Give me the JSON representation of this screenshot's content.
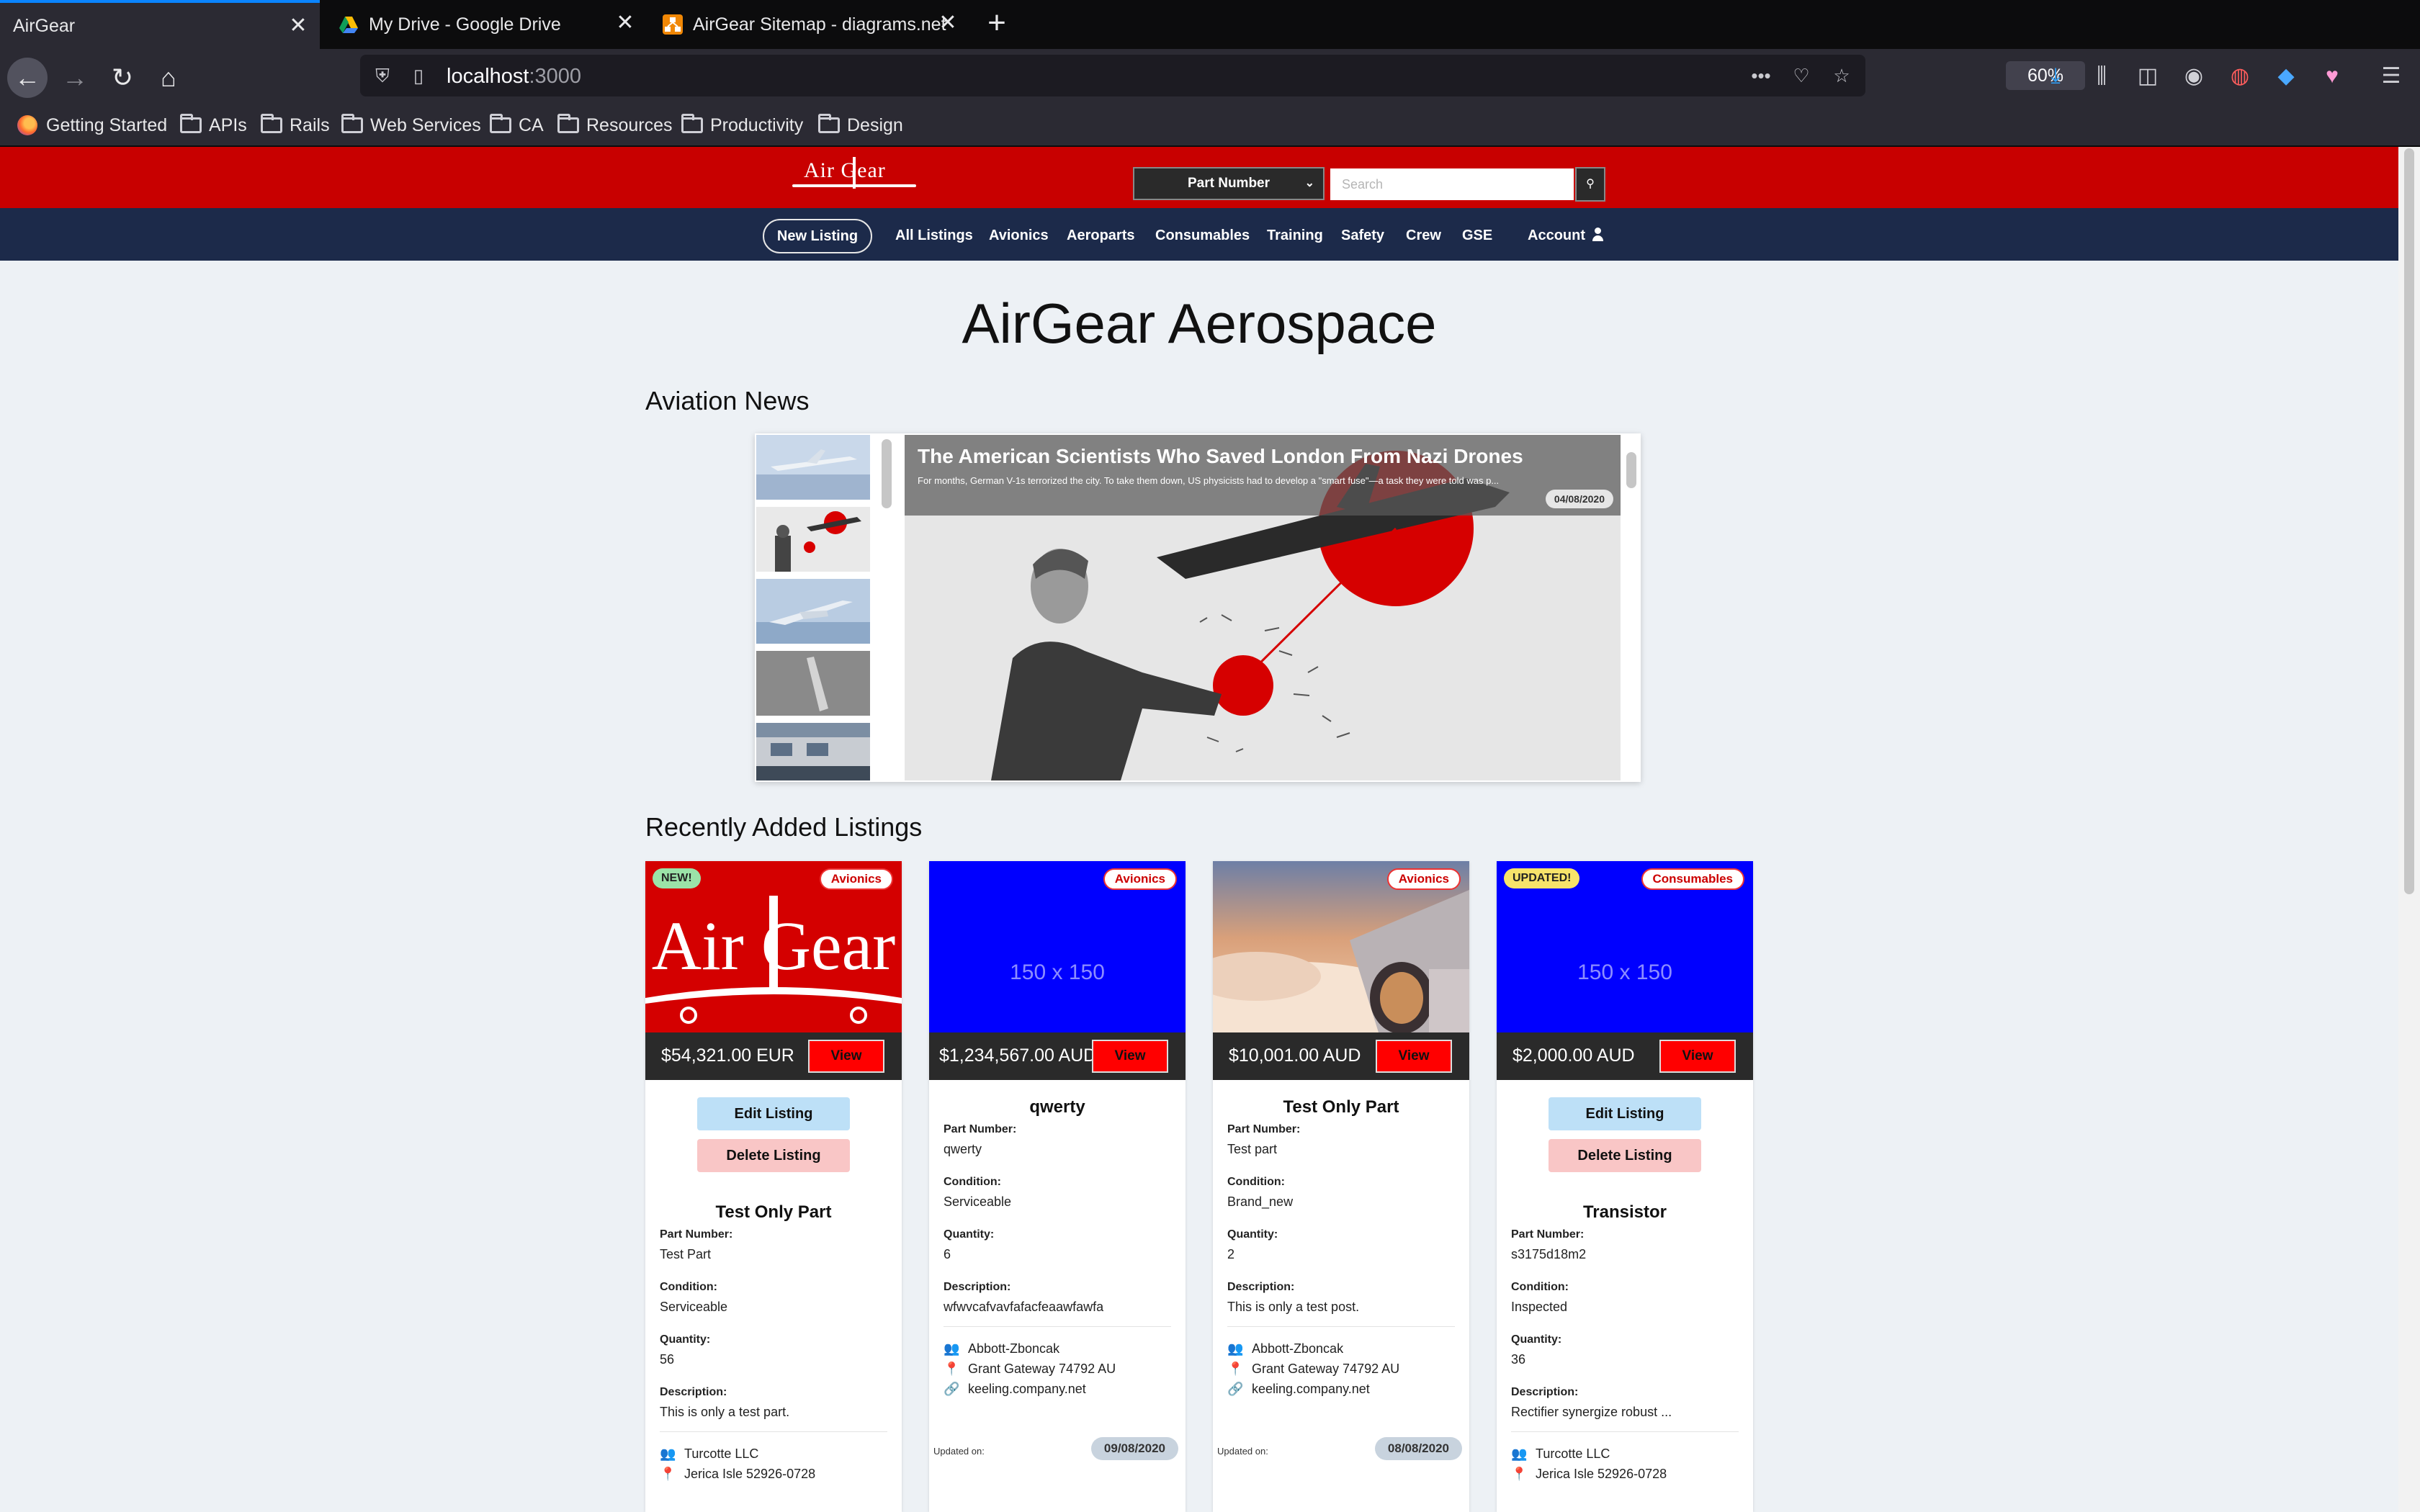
{
  "browser": {
    "tabs": [
      {
        "title": "AirGear"
      },
      {
        "title": "My Drive - Google Drive"
      },
      {
        "title": "AirGear Sitemap - diagrams.net"
      }
    ],
    "url_host": "localhost",
    "url_port": ":3000",
    "zoom": "60%",
    "bookmarks": [
      "Getting Started",
      "APIs",
      "Rails",
      "Web Services",
      "CA",
      "Resources",
      "Productivity",
      "Design"
    ]
  },
  "site": {
    "logo_text": "Air Gear",
    "search": {
      "select_value": "Part Number",
      "placeholder": "Search"
    },
    "nav": {
      "new_listing": "New Listing",
      "links": [
        "All Listings",
        "Avionics",
        "Aeroparts",
        "Consumables",
        "Training",
        "Safety",
        "Crew",
        "GSE"
      ],
      "account": "Account"
    },
    "page_title": "AirGear Aerospace",
    "news_title": "Aviation News",
    "listings_title": "Recently Added Listings"
  },
  "news": {
    "headline": "The American Scientists Who Saved London From Nazi Drones",
    "description": "For months, German V-1s terrorized the city. To take them down, US physicists had to develop a \"smart fuse\"—a task they were told was p...",
    "date": "04/08/2020"
  },
  "labels": {
    "part_number": "Part Number:",
    "condition": "Condition:",
    "quantity": "Quantity:",
    "description": "Description:",
    "updated_on": "Updated on:",
    "view": "View",
    "edit": "Edit Listing",
    "delete": "Delete Listing",
    "placeholder_image": "150 x 150"
  },
  "listings": [
    {
      "status": "NEW!",
      "category": "Avionics",
      "price": "$54,321.00 EUR",
      "name": "Test Only Part",
      "part_number": "Test Part",
      "condition": "Serviceable",
      "quantity": "56",
      "description": "This is only a test part.",
      "company": "Turcotte LLC",
      "address": "Jerica Isle 52926-0728",
      "website": "",
      "updated": ""
    },
    {
      "status": "",
      "category": "Avionics",
      "price": "$1,234,567.00 AUD",
      "name": "qwerty",
      "part_number": "qwerty",
      "condition": "Serviceable",
      "quantity": "6",
      "description": "wfwvcafvavfafacfeaawfawfa",
      "company": "Abbott-Zboncak",
      "address": "Grant Gateway 74792 AU",
      "website": "keeling.company.net",
      "updated": "09/08/2020"
    },
    {
      "status": "",
      "category": "Avionics",
      "price": "$10,001.00 AUD",
      "name": "Test Only Part",
      "part_number": "Test part",
      "condition": "Brand_new",
      "quantity": "2",
      "description": "This is only a test post.",
      "company": "Abbott-Zboncak",
      "address": "Grant Gateway 74792 AU",
      "website": "keeling.company.net",
      "updated": "08/08/2020"
    },
    {
      "status": "UPDATED!",
      "category": "Consumables",
      "price": "$2,000.00 AUD",
      "name": "Transistor",
      "part_number": "s3175d18m2",
      "condition": "Inspected",
      "quantity": "36",
      "description": "Rectifier synergize robust ...",
      "company": "Turcotte LLC",
      "address": "Jerica Isle 52926-0728",
      "website": "",
      "updated": ""
    }
  ],
  "colors": {
    "header_red": "#c80000",
    "nav_navy": "#1c2a4a",
    "new_badge": "#9be3a8",
    "updated_badge": "#f7e36a",
    "view_red": "#ff0000"
  }
}
